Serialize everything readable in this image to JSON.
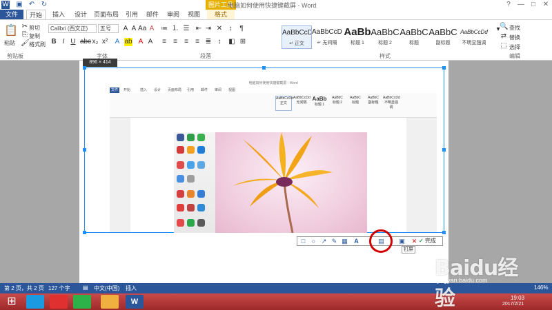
{
  "window": {
    "title": "电脑如何使用快捷键截屏 - Word",
    "picture_tools": "图片工具",
    "help": "?",
    "minimize": "—",
    "restore": "□",
    "close": "✕"
  },
  "tabs": [
    "文件",
    "开始",
    "插入",
    "设计",
    "页面布局",
    "引用",
    "邮件",
    "审阅",
    "视图",
    "格式"
  ],
  "ribbon": {
    "clipboard": {
      "paste": "粘贴",
      "cut": "剪切",
      "copy": "复制",
      "format_painter": "格式刷",
      "label": "剪贴板"
    },
    "font": {
      "name": "Calibri (西文正)",
      "size": "五号",
      "label": "字体"
    },
    "paragraph": {
      "label": "段落"
    },
    "styles": {
      "label": "样式",
      "items": [
        {
          "sample": "AaBbCcDd",
          "name": "↵ 正文"
        },
        {
          "sample": "AaBbCcDd",
          "name": "↵ 无间隔"
        },
        {
          "sample": "AaBb",
          "name": "标题 1"
        },
        {
          "sample": "AaBbC",
          "name": "标题 2"
        },
        {
          "sample": "AaBbC",
          "name": "标题"
        },
        {
          "sample": "AaBbC",
          "name": "副标题"
        },
        {
          "sample": "AaBbCcDd",
          "name": "不明显强调"
        }
      ]
    },
    "editing": {
      "find": "查找",
      "replace": "替换",
      "select": "选择",
      "label": "编辑"
    }
  },
  "capture": {
    "size_label": "896 × 414",
    "inner_title": "电脑如何使用快捷键截屏 - Word",
    "inner_tabs": [
      "文件",
      "开始",
      "插入",
      "设计",
      "页面布局",
      "引用",
      "邮件",
      "审阅",
      "视图"
    ],
    "inner_styles": [
      "正文",
      "无间隔",
      "标题 1",
      "标题 2",
      "标题",
      "副标题",
      "不明显强调"
    ]
  },
  "snip_toolbar": {
    "tools": [
      "rectangle-icon",
      "ellipse-icon",
      "arrow-icon",
      "pen-icon",
      "mosaic-icon",
      "text-icon",
      "save-icon",
      "pin-icon",
      "cancel-icon"
    ],
    "finish": "完成",
    "tooltip": "钉屏"
  },
  "status": {
    "page": "第 2 页，共 2 页",
    "words": "127 个字",
    "lang": "中文(中国)",
    "mode": "插入",
    "zoom": "146%"
  },
  "taskbar": {
    "time": "19:03",
    "date": "2017/2/21"
  },
  "watermark": {
    "brand": "Baidu经验",
    "url": "jingyan.baidu.com"
  }
}
